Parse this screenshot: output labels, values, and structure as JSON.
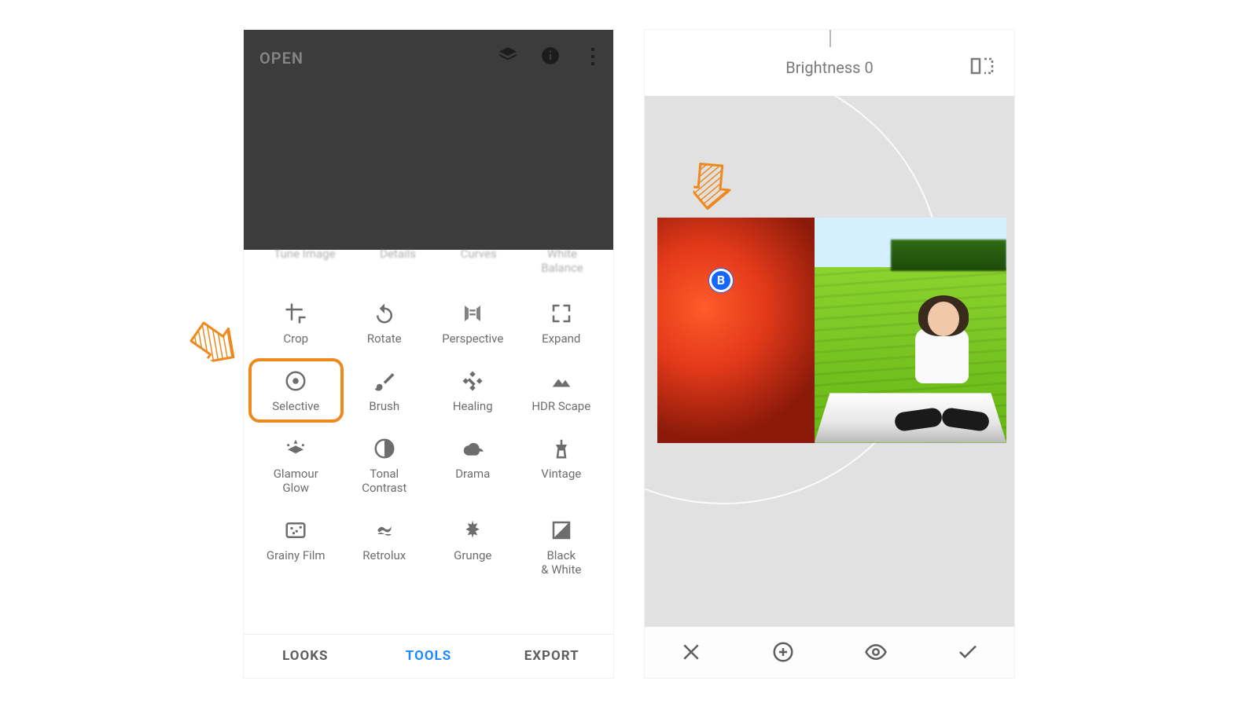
{
  "left": {
    "open_label": "OPEN",
    "crumbs": [
      "Tune Image",
      "Details",
      "Curves",
      "White\nBalance"
    ],
    "tools": [
      {
        "label": "Crop",
        "icon": "crop-icon"
      },
      {
        "label": "Rotate",
        "icon": "rotate-icon"
      },
      {
        "label": "Perspective",
        "icon": "perspective-icon"
      },
      {
        "label": "Expand",
        "icon": "expand-icon"
      },
      {
        "label": "Selective",
        "icon": "selective-icon",
        "highlight": true
      },
      {
        "label": "Brush",
        "icon": "brush-icon"
      },
      {
        "label": "Healing",
        "icon": "healing-icon"
      },
      {
        "label": "HDR Scape",
        "icon": "hdr-icon"
      },
      {
        "label": "Glamour\nGlow",
        "icon": "glamour-icon"
      },
      {
        "label": "Tonal\nContrast",
        "icon": "tonal-icon"
      },
      {
        "label": "Drama",
        "icon": "drama-icon"
      },
      {
        "label": "Vintage",
        "icon": "vintage-icon"
      },
      {
        "label": "Grainy Film",
        "icon": "grainy-icon"
      },
      {
        "label": "Retrolux",
        "icon": "retrolux-icon"
      },
      {
        "label": "Grunge",
        "icon": "grunge-icon"
      },
      {
        "label": "Black\n& White",
        "icon": "bw-icon"
      }
    ],
    "tabs": {
      "looks": "LOOKS",
      "tools": "TOOLS",
      "export": "EXPORT",
      "active": "tools"
    }
  },
  "right": {
    "param_name": "Brightness",
    "param_value": 0,
    "point_label": "B",
    "actions": [
      "cancel",
      "add-point",
      "view",
      "apply"
    ]
  },
  "colors": {
    "accent_orange": "#ee8a1d",
    "accent_blue": "#1e88ff"
  }
}
